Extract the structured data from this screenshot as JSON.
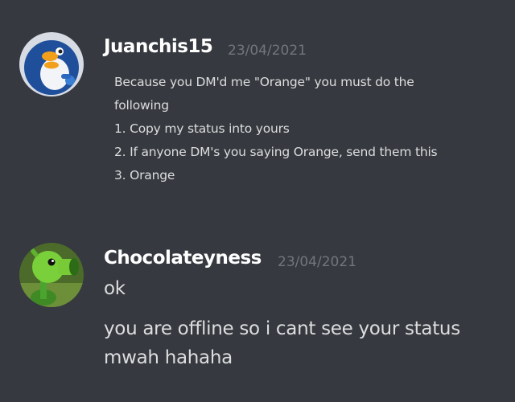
{
  "messages": [
    {
      "author": "Juanchis15",
      "timestamp": "23/04/2021",
      "avatar_icon": "penguin-avatar-icon",
      "lines": [
        "Because you DM'd me \"Orange\" you must do the",
        "following",
        "1. Copy my status into yours",
        "2. If anyone DM's you saying Orange, send them this",
        "3. Orange"
      ]
    },
    {
      "author": "Chocolateyness",
      "timestamp": "23/04/2021",
      "avatar_icon": "peashooter-avatar-icon",
      "lines": [
        "ok",
        "you are offline so i cant see your status",
        "mwah hahaha"
      ]
    }
  ],
  "colors": {
    "background": "#36393f",
    "username": "#ffffff",
    "text": "#dcddde",
    "timestamp": "#72767d"
  }
}
